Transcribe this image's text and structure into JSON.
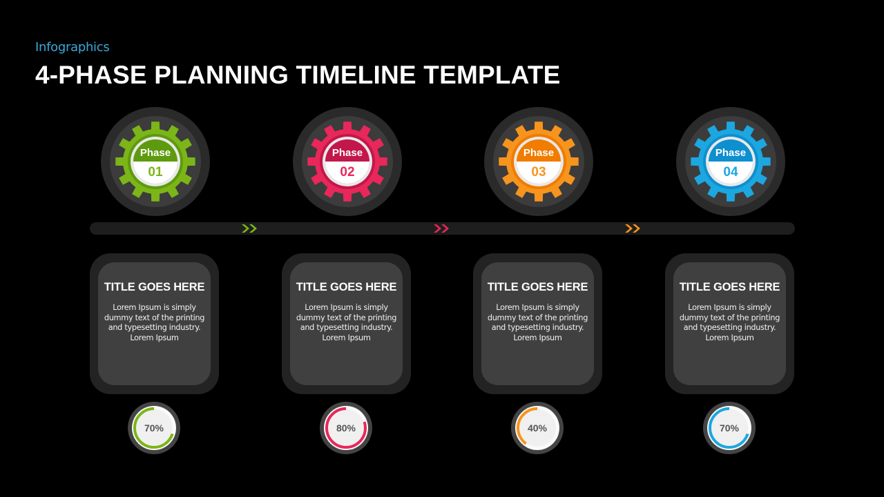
{
  "header": {
    "subtitle": "Infographics",
    "title": "4-PHASE PLANNING TIMELINE TEMPLATE"
  },
  "phases": [
    {
      "label": "Phase",
      "number": "01",
      "color": "#7cb518",
      "color_dark": "#5e9a0e",
      "card_title": "TITLE GOES HERE",
      "card_body": "Lorem Ipsum is simply dummy text of the printing and typesetting industry. Lorem Ipsum",
      "progress": 70,
      "progress_label": "70%"
    },
    {
      "label": "Phase",
      "number": "02",
      "color": "#e8275a",
      "color_dark": "#c2174a",
      "card_title": "TITLE GOES HERE",
      "card_body": "Lorem Ipsum is simply dummy text of the printing and typesetting industry. Lorem Ipsum",
      "progress": 80,
      "progress_label": "80%"
    },
    {
      "label": "Phase",
      "number": "03",
      "color": "#f7941d",
      "color_dark": "#f07c00",
      "card_title": "TITLE GOES HERE",
      "card_body": "Lorem Ipsum is simply dummy text of the printing and typesetting industry. Lorem Ipsum",
      "progress": 40,
      "progress_label": "40%"
    },
    {
      "label": "Phase",
      "number": "04",
      "color": "#1ca7e0",
      "color_dark": "#0e8fcf",
      "card_title": "TITLE GOES HERE",
      "card_body": "Lorem Ipsum is simply dummy text of the printing and typesetting industry. Lorem Ipsum",
      "progress": 70,
      "progress_label": "70%"
    }
  ],
  "connectors": [
    {
      "icon": "double-chevron-right-icon",
      "color": "#7cb518"
    },
    {
      "icon": "double-chevron-right-icon",
      "color": "#e8275a"
    },
    {
      "icon": "double-chevron-right-icon",
      "color": "#f7941d"
    }
  ]
}
